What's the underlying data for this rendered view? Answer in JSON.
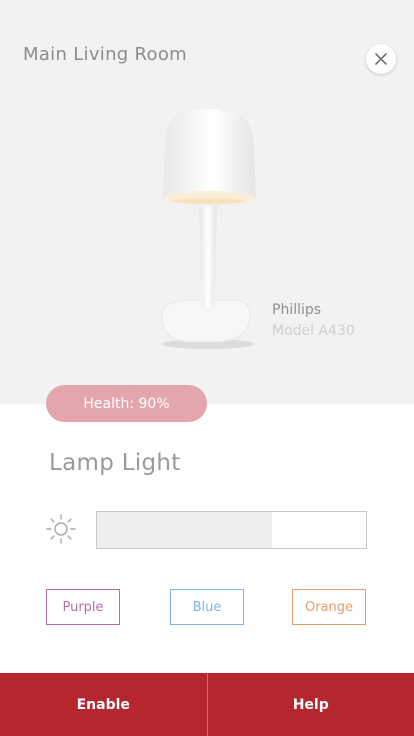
{
  "header": {
    "room_name": "Main Living Room",
    "close_icon": "close-icon"
  },
  "product": {
    "brand": "Phillips",
    "model": "Model A430"
  },
  "health": {
    "label": "Health: 90%",
    "value_percent": 90,
    "color": "#e4a6ad"
  },
  "device": {
    "title": "Lamp Light"
  },
  "brightness": {
    "icon": "sun-icon",
    "value_fraction": 0.65
  },
  "colors": [
    {
      "label": "Purple",
      "color": "#b56ea7"
    },
    {
      "label": "Blue",
      "color": "#7fb6e6"
    },
    {
      "label": "Orange",
      "color": "#e79a6c"
    }
  ],
  "footer": {
    "enable_label": "Enable",
    "help_label": "Help",
    "accent": "#b5262e"
  }
}
